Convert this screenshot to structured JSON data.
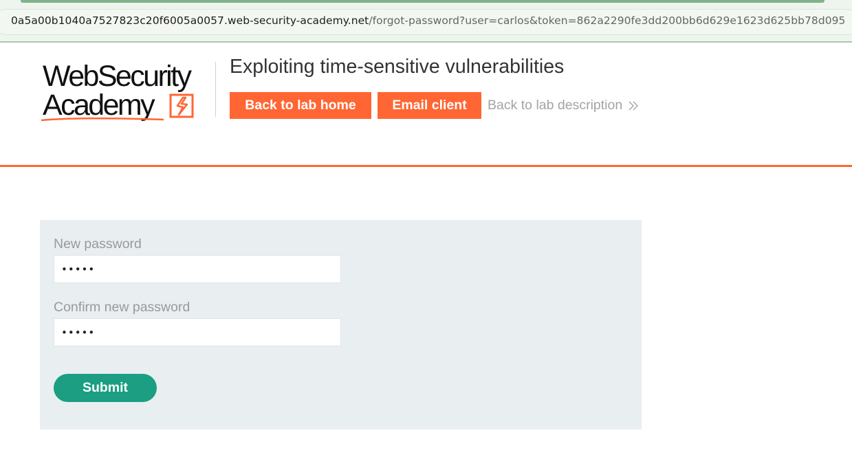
{
  "browser": {
    "url_host": "0a5a00b1040a7527823c20f6005a0057.web-security-academy.net",
    "url_path": "/forgot-password?user=carlos&token=862a2290fe3dd200bb6d629e1623d625bb78d095"
  },
  "header": {
    "logo_line1": "WebSecurity",
    "logo_line2": "Academy",
    "lab_title": "Exploiting time-sensitive vulnerabilities",
    "back_home_label": "Back to lab home",
    "email_client_label": "Email client",
    "back_description_label": "Back to lab description",
    "accent_color": "#ff6633"
  },
  "form": {
    "new_password_label": "New password",
    "new_password_value": "•••••",
    "confirm_password_label": "Confirm new password",
    "confirm_password_value": "•••••",
    "submit_label": "Submit",
    "submit_color": "#1b9e82"
  },
  "icons": {
    "logo_mark": "lightning-bolt-icon",
    "link_arrow": "double-chevron-right-icon"
  }
}
